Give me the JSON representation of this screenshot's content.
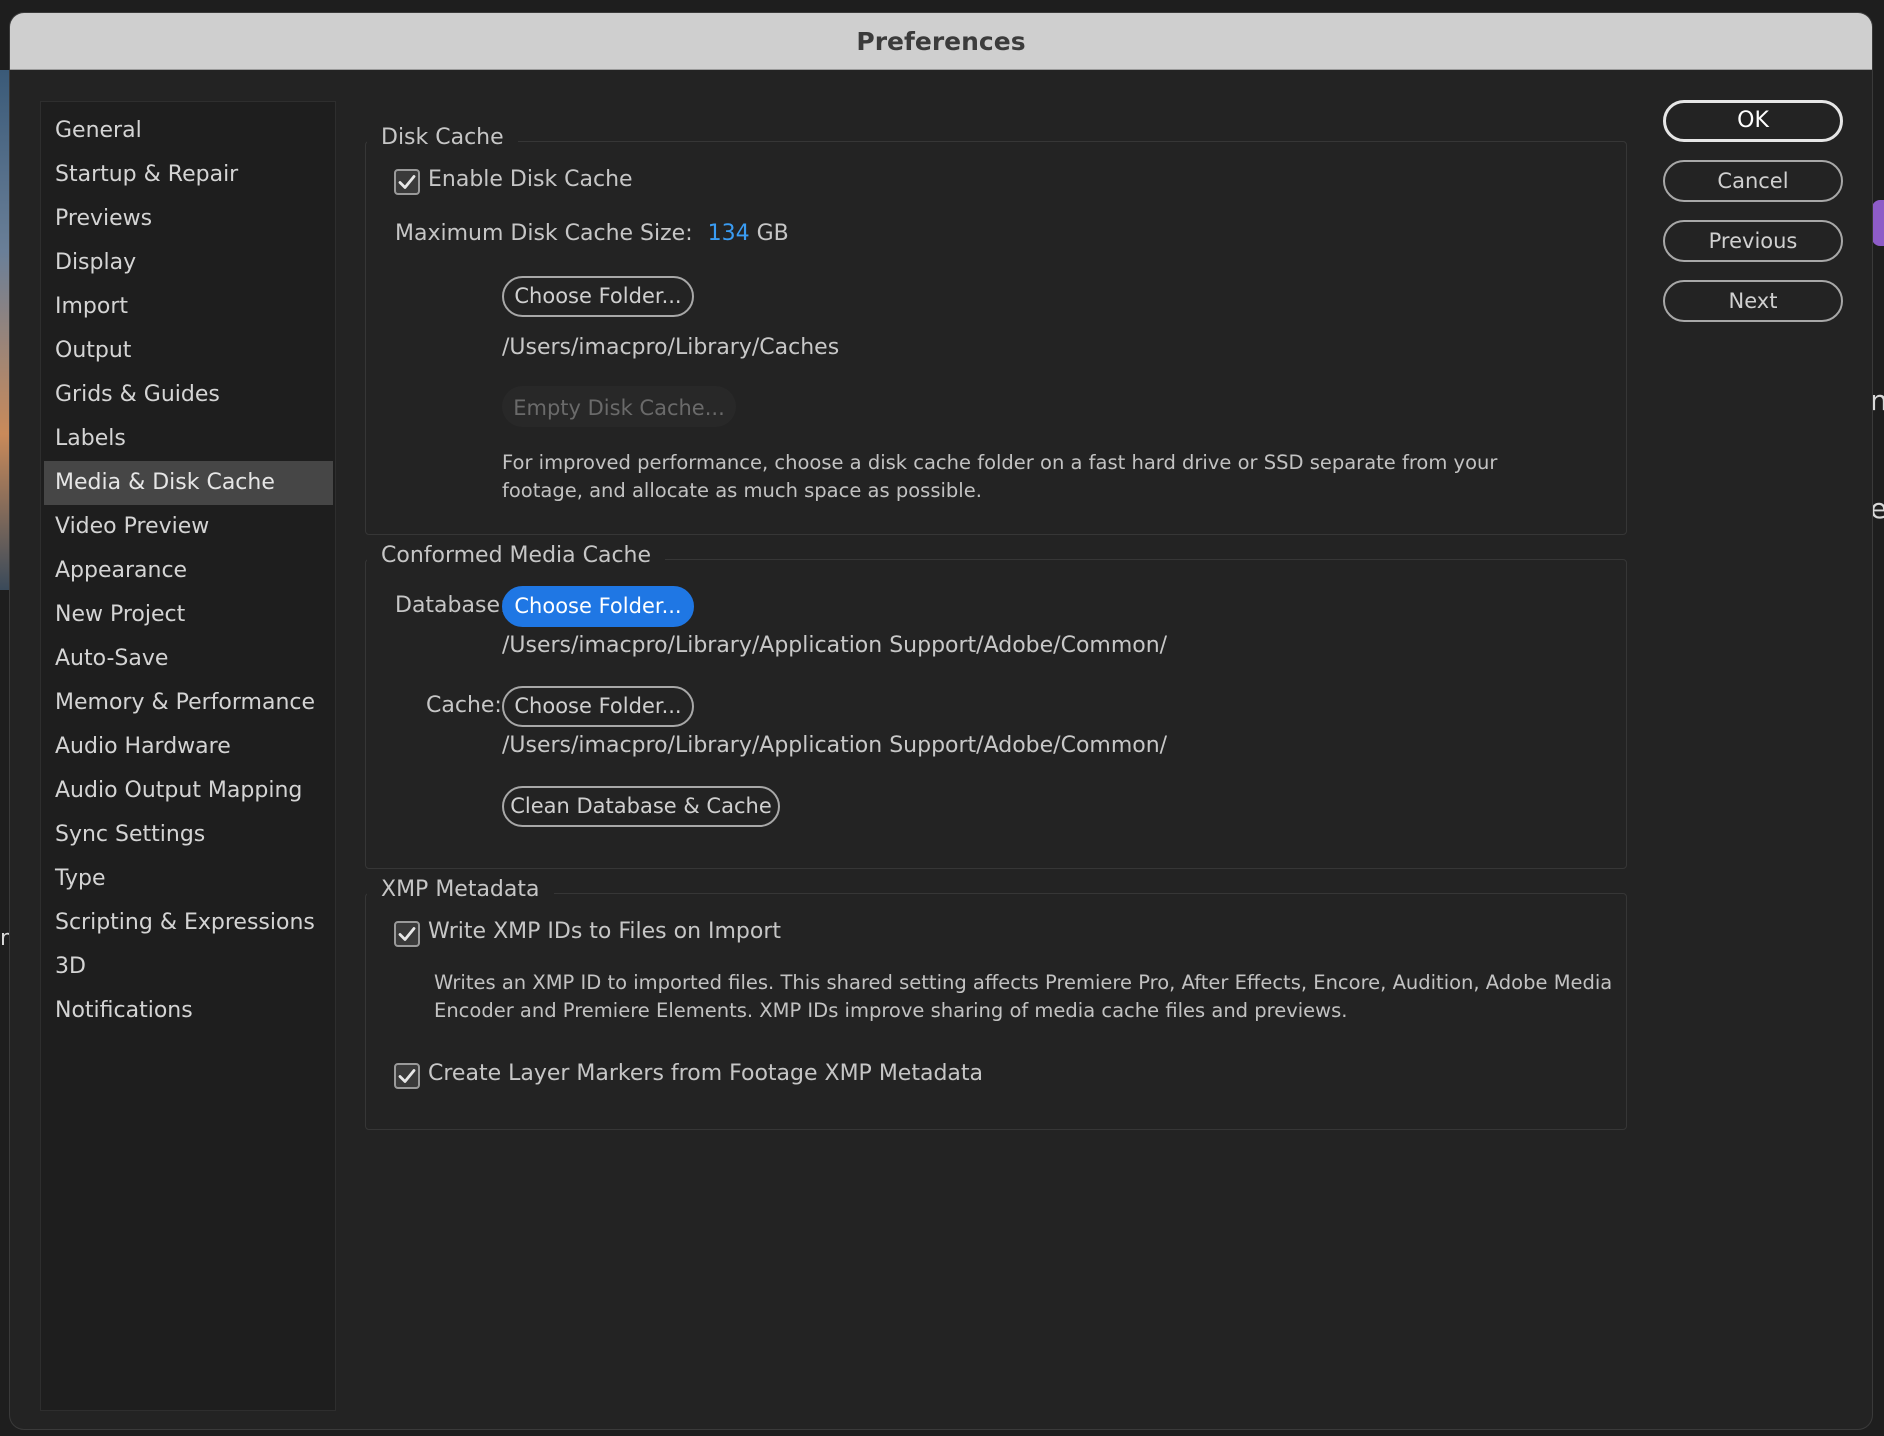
{
  "window": {
    "title": "Preferences"
  },
  "sidebar": {
    "items": [
      {
        "label": "General"
      },
      {
        "label": "Startup & Repair"
      },
      {
        "label": "Previews"
      },
      {
        "label": "Display"
      },
      {
        "label": "Import"
      },
      {
        "label": "Output"
      },
      {
        "label": "Grids & Guides"
      },
      {
        "label": "Labels"
      },
      {
        "label": "Media & Disk Cache",
        "selected": true
      },
      {
        "label": "Video Preview"
      },
      {
        "label": "Appearance"
      },
      {
        "label": "New Project"
      },
      {
        "label": "Auto-Save"
      },
      {
        "label": "Memory & Performance"
      },
      {
        "label": "Audio Hardware"
      },
      {
        "label": "Audio Output Mapping"
      },
      {
        "label": "Sync Settings"
      },
      {
        "label": "Type"
      },
      {
        "label": "Scripting & Expressions"
      },
      {
        "label": "3D"
      },
      {
        "label": "Notifications"
      }
    ]
  },
  "disk_cache": {
    "title": "Disk Cache",
    "enable_label": "Enable Disk Cache",
    "enable_checked": true,
    "max_size_label": "Maximum Disk Cache Size:",
    "max_size_value": "134",
    "max_size_unit": "GB",
    "choose_folder_label": "Choose Folder...",
    "folder_path": "/Users/imacpro/Library/Caches",
    "empty_label": "Empty Disk Cache...",
    "help_text": "For improved performance, choose a disk cache folder on a fast hard drive or SSD separate from your footage, and allocate as much space as possible."
  },
  "conformed_media_cache": {
    "title": "Conformed Media Cache",
    "database_label": "Database:",
    "database_button": "Choose Folder...",
    "database_path": "/Users/imacpro/Library/Application Support/Adobe/Common/",
    "cache_label": "Cache:",
    "cache_button": "Choose Folder...",
    "cache_path": "/Users/imacpro/Library/Application Support/Adobe/Common/",
    "clean_button": "Clean Database & Cache"
  },
  "xmp_metadata": {
    "title": "XMP Metadata",
    "write_ids_label": "Write XMP IDs to Files on Import",
    "write_ids_checked": true,
    "write_ids_help": "Writes an XMP ID to imported files. This shared setting affects Premiere Pro, After Effects, Encore, Audition, Adobe Media Encoder and Premiere Elements. XMP IDs improve sharing of media cache files and previews.",
    "layer_markers_label": "Create Layer Markers from Footage XMP Metadata",
    "layer_markers_checked": true
  },
  "actions": {
    "ok": "OK",
    "cancel": "Cancel",
    "previous": "Previous",
    "next": "Next"
  },
  "backdrop": {
    "right_text_1": "n",
    "right_text_2": "ea",
    "left_text": "n"
  },
  "colors": {
    "accent": "#1f77e4",
    "link_value": "#3a9cf2",
    "dialog_bg": "#232323",
    "titlebar_bg": "#cfcfcf"
  }
}
